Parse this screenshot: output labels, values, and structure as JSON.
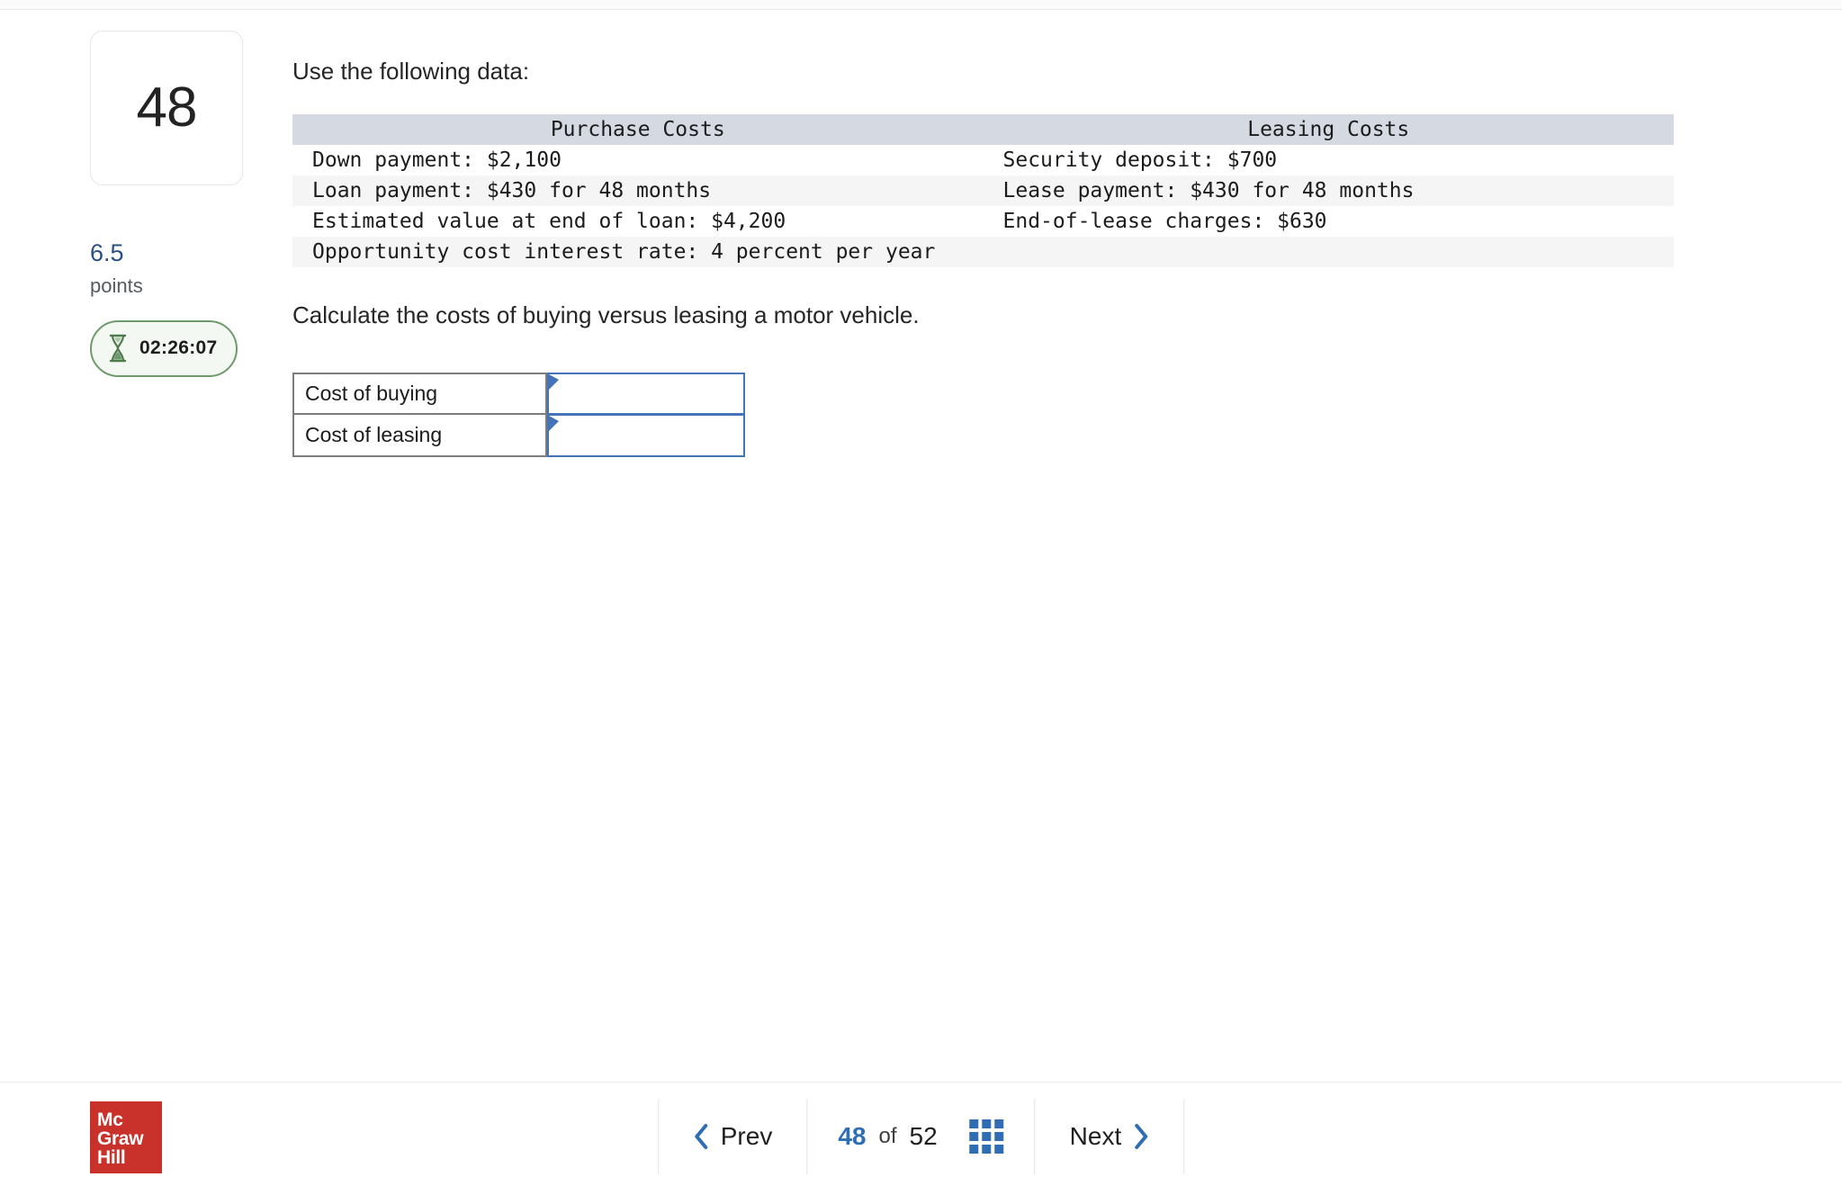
{
  "question": {
    "number": "48",
    "points_value": "6.5",
    "points_label": "points",
    "timer": "02:26:07",
    "prompt": "Use the following data:",
    "instruction": "Calculate the costs of buying versus leasing a motor vehicle."
  },
  "data_table": {
    "headers": [
      "Purchase Costs",
      "Leasing Costs"
    ],
    "rows": [
      [
        "Down payment: $2,100",
        "Security deposit: $700"
      ],
      [
        "Loan payment: $430 for 48 months",
        "Lease payment: $430 for 48 months"
      ],
      [
        "Estimated value at end of loan: $4,200",
        "End-of-lease charges: $630"
      ],
      [
        "Opportunity cost interest rate: 4 percent per year",
        ""
      ]
    ]
  },
  "answer_table": {
    "rows": [
      {
        "label": "Cost of buying",
        "value": "",
        "placeholder": ""
      },
      {
        "label": "Cost of leasing",
        "value": "",
        "placeholder": ""
      }
    ]
  },
  "footer": {
    "logo": {
      "line1": "Mc",
      "line2": "Graw",
      "line3": "Hill"
    },
    "prev_label": "Prev",
    "next_label": "Next",
    "pager": {
      "current": "48",
      "of": "of",
      "total": "52"
    }
  },
  "colors": {
    "accent_blue": "#2f6db5",
    "input_blue": "#4573b8",
    "header_band": "#d4d9e2",
    "row_stripe": "#f5f5f5",
    "timer_green": "#6f9a6c",
    "logo_red": "#c9312b",
    "points_blue": "#2b4f80"
  }
}
